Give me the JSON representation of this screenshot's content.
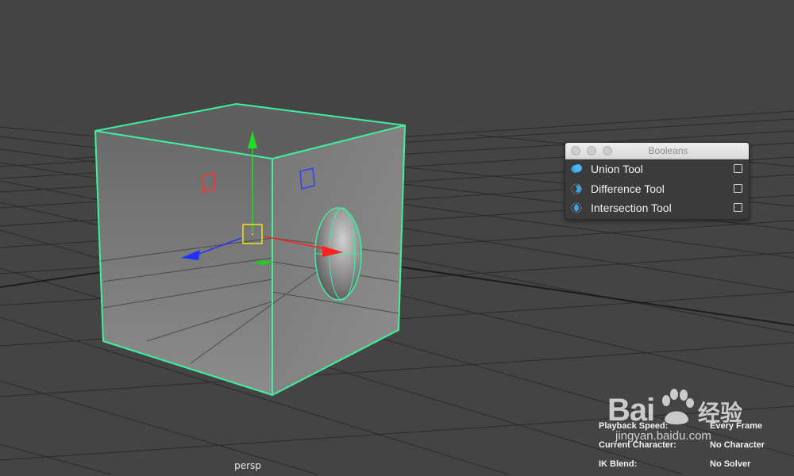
{
  "viewport": {
    "camera_label": "persp"
  },
  "hud": {
    "rows": [
      {
        "label": "Playback Speed:",
        "value": "Every Frame"
      },
      {
        "label": "Current Character:",
        "value": "No Character"
      },
      {
        "label": "IK Blend:",
        "value": "No Solver"
      }
    ]
  },
  "booleans_panel": {
    "title": "Booleans",
    "tools": [
      {
        "label": "Union Tool",
        "icon": "union-icon",
        "checked": false
      },
      {
        "label": "Difference Tool",
        "icon": "difference-icon",
        "checked": false
      },
      {
        "label": "Intersection Tool",
        "icon": "intersection-icon",
        "checked": false
      }
    ]
  },
  "watermark": {
    "brand": "Bai",
    "brand_cn": "经验",
    "url": "jingyan.baidu.com"
  },
  "colors": {
    "viewport_bg": "#444444",
    "selection_wire": "#3ef0a0",
    "x_axis": "#ff2020",
    "y_axis": "#22dd22",
    "z_axis": "#2233ff",
    "pivot": "#f2e21a",
    "tool_icon_blue": "#3aa0e8"
  }
}
